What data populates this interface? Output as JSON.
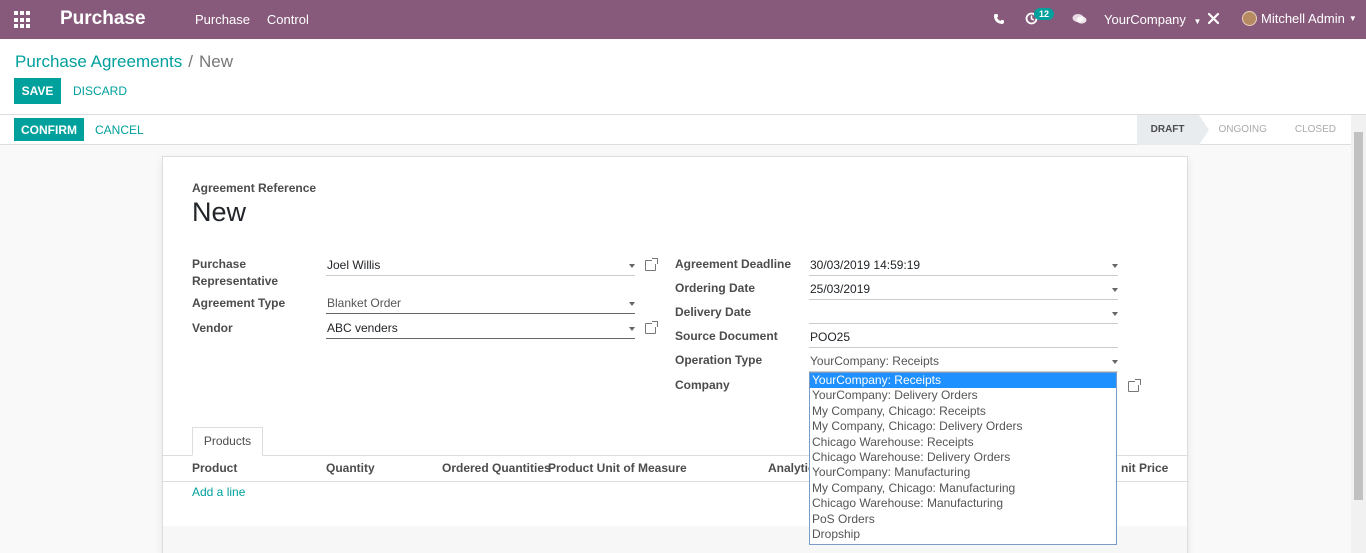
{
  "navbar": {
    "brand": "Purchase",
    "menu": [
      "Purchase",
      "Control"
    ],
    "activity_count": "12",
    "company": "YourCompany",
    "user": "Mitchell Admin"
  },
  "breadcrumb": {
    "parent": "Purchase Agreements",
    "separator": "/",
    "current": "New"
  },
  "actions": {
    "save": "SAVE",
    "discard": "DISCARD",
    "confirm": "CONFIRM",
    "cancel": "CANCEL"
  },
  "stages": [
    "DRAFT",
    "ONGOING",
    "CLOSED"
  ],
  "form": {
    "ref_label": "Agreement Reference",
    "ref_value": "New",
    "labels": {
      "representative_1": "Purchase",
      "representative_2": "Representative",
      "agreement_type": "Agreement Type",
      "vendor": "Vendor",
      "deadline": "Agreement Deadline",
      "ordering_date": "Ordering Date",
      "delivery_date": "Delivery Date",
      "source_document": "Source Document",
      "operation_type": "Operation Type",
      "company": "Company"
    },
    "values": {
      "representative": "Joel Willis",
      "agreement_type": "Blanket Order",
      "vendor": "ABC venders",
      "deadline": "30/03/2019 14:59:19",
      "ordering_date": "25/03/2019",
      "delivery_date": "",
      "source_document": "POO25",
      "operation_type": "YourCompany: Receipts"
    }
  },
  "tabs": [
    "Products"
  ],
  "table": {
    "columns": [
      "Product",
      "Quantity",
      "Ordered Quantities",
      "Product Unit of Measure",
      "Analytic",
      "nit Price"
    ],
    "add_line": "Add a line"
  },
  "operation_type_options": [
    "YourCompany: Receipts",
    "YourCompany: Delivery Orders",
    "My Company, Chicago: Receipts",
    "My Company, Chicago: Delivery Orders",
    "Chicago Warehouse: Receipts",
    "Chicago Warehouse: Delivery Orders",
    "YourCompany: Manufacturing",
    "My Company, Chicago: Manufacturing",
    "Chicago Warehouse: Manufacturing",
    "PoS Orders",
    "Dropship"
  ],
  "colors": {
    "navbar": "#875a7b",
    "primary": "#00a09d",
    "selected": "#1e90ff"
  }
}
